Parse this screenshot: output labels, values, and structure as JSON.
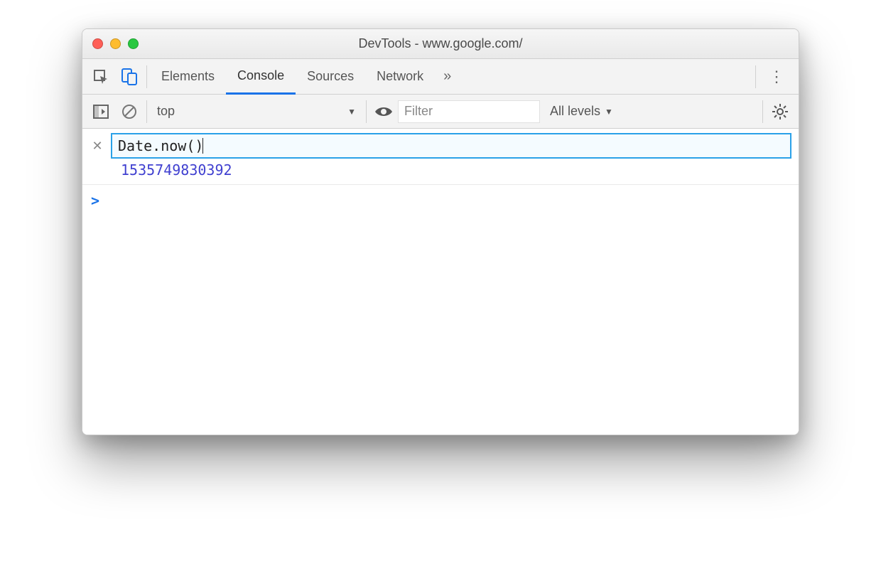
{
  "window": {
    "title": "DevTools - www.google.com/"
  },
  "tabs": {
    "items": [
      "Elements",
      "Console",
      "Sources",
      "Network"
    ],
    "active": "Console",
    "overflow_glyph": "»"
  },
  "filterbar": {
    "context": "top",
    "filter_placeholder": "Filter",
    "filter_value": "",
    "levels_label": "All levels"
  },
  "console": {
    "eager_expression": "Date.now()",
    "eager_result": "1535749830392",
    "prompt_glyph": ">"
  },
  "icons": {
    "inspect": "inspect-icon",
    "device": "device-icon",
    "sidebar": "show-console-sidebar-icon",
    "clear": "clear-console-icon",
    "eye": "live-expression-icon",
    "settings": "settings-icon",
    "kebab": "menu-icon",
    "close": "close-icon",
    "dropdown": "dropdown-icon"
  },
  "colors": {
    "accent": "#1a73e8",
    "eager_border": "#2aa1e8",
    "result_text": "#4040d0"
  }
}
